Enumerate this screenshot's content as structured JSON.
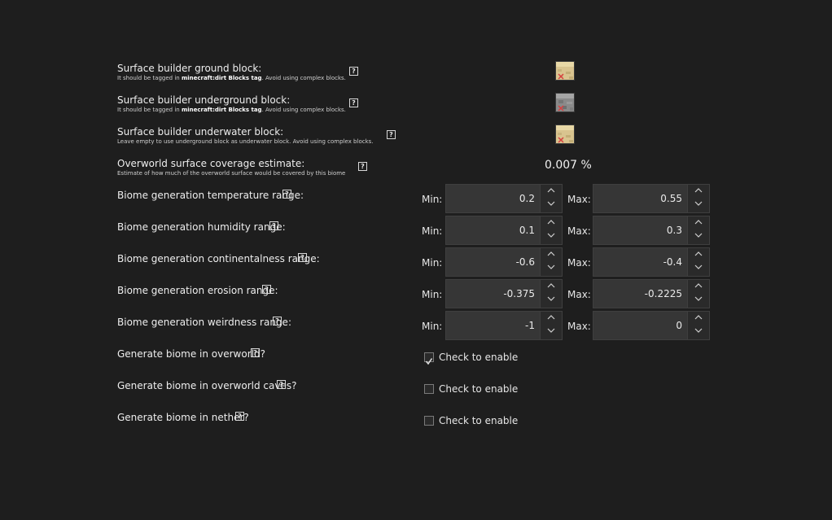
{
  "rows": {
    "ground": {
      "title": "Surface builder ground block:",
      "desc_prefix": "It should be tagged in ",
      "desc_bold": "minecraft:dirt Blocks tag",
      "desc_suffix": ". Avoid using complex blocks.",
      "help": "?"
    },
    "underground": {
      "title": "Surface builder underground block:",
      "desc_prefix": "It should be tagged in ",
      "desc_bold": "minecraft:dirt Blocks tag",
      "desc_suffix": ". Avoid using complex blocks.",
      "help": "?"
    },
    "underwater": {
      "title": "Surface builder underwater block:",
      "desc": "Leave empty to use underground block as underwater block. Avoid using complex blocks.",
      "help": "?"
    },
    "coverage": {
      "title": "Overworld surface coverage estimate:",
      "desc": "Estimate of how much of the overworld surface would be covered by this biome",
      "help": "?",
      "value": "0.007 %"
    },
    "temperature": {
      "title": "Biome generation temperature range:",
      "help": "?"
    },
    "humidity": {
      "title": "Biome generation humidity range:",
      "help": "?"
    },
    "continentalness": {
      "title": "Biome generation continentalness range:",
      "help": "?"
    },
    "erosion": {
      "title": "Biome generation erosion range:",
      "help": "?"
    },
    "weirdness": {
      "title": "Biome generation weirdness range:",
      "help": "?"
    },
    "gen_overworld": {
      "title": "Generate biome in overworld?",
      "help": "?",
      "checkbox_label": "Check to enable",
      "checked": true
    },
    "gen_caves": {
      "title": "Generate biome in overworld caves?",
      "help": "?",
      "checkbox_label": "Check to enable",
      "checked": false
    },
    "gen_nether": {
      "title": "Generate biome in nether?",
      "help": "?",
      "checkbox_label": "Check to enable",
      "checked": false
    }
  },
  "range_labels": {
    "min": "Min:",
    "max": "Max:"
  },
  "ranges": {
    "temperature": {
      "min": "0.2",
      "max": "0.55"
    },
    "humidity": {
      "min": "0.1",
      "max": "0.3"
    },
    "continentalness": {
      "min": "-0.6",
      "max": "-0.4"
    },
    "erosion": {
      "min": "-0.375",
      "max": "-0.2225"
    },
    "weirdness": {
      "min": "-1",
      "max": "0"
    }
  },
  "blocks": {
    "ground": "sandstone-block-icon",
    "underground": "stone-block-icon",
    "underwater": "sandstone-block-icon"
  },
  "colors": {
    "background": "#1e1e1e",
    "field": "#363636",
    "text": "#e6e6e6"
  }
}
